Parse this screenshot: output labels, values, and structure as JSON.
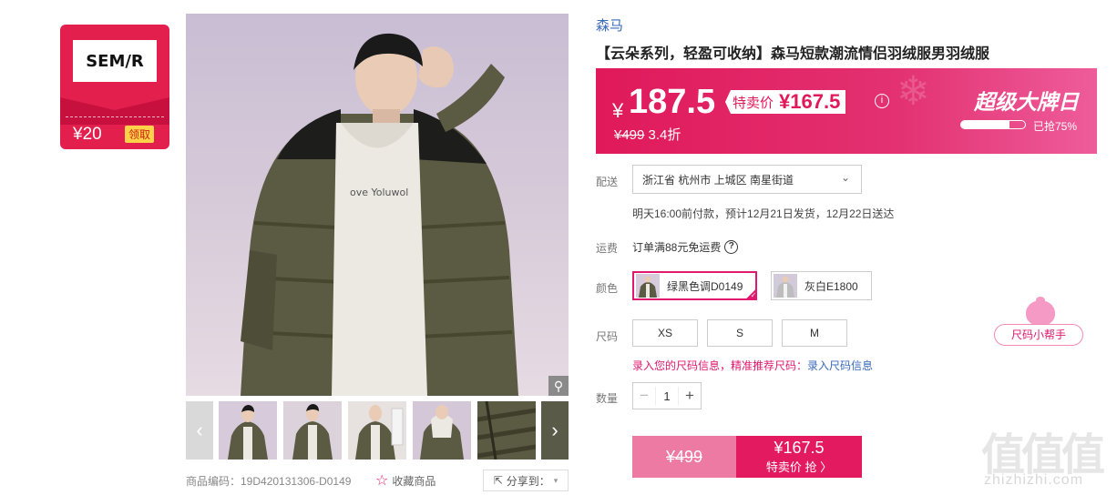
{
  "brand_card": {
    "logo_text": "SEM/R",
    "coupon_amount": "¥20",
    "claim_label": "领取"
  },
  "gallery": {
    "zoom_icon": "magnifier-icon",
    "prev_icon": "chevron-left-icon",
    "next_icon": "chevron-right-icon",
    "thumbnail_count": 6
  },
  "meta": {
    "product_code": "商品编码：19D420131306-D0149",
    "favorite_label": "收藏商品",
    "share_label": "分享到："
  },
  "product": {
    "brand": "森马",
    "title": "【云朵系列，轻盈可收纳】森马短款潮流情侣羽绒服男羽绒服"
  },
  "price": {
    "currency": "¥",
    "current": "187.5",
    "promo_label": "特卖价",
    "promo_price": "¥167.5",
    "original": "¥499",
    "discount": "3.4折",
    "event_name": "超级大牌日",
    "sold_label": "已抢75%",
    "sold_fraction": 0.75,
    "accent": "#e0195a"
  },
  "delivery": {
    "label": "配送",
    "location": "浙江省 杭州市 上城区 南星街道",
    "note": "明天16:00前付款，预计12月21日发货，12月22日送达"
  },
  "shipping_fee": {
    "label": "运费",
    "text": "订单满88元免运费"
  },
  "color": {
    "label": "颜色",
    "options": [
      {
        "name": "绿黑色调D0149",
        "selected": true
      },
      {
        "name": "灰白E1800",
        "selected": false
      }
    ]
  },
  "size": {
    "label": "尺码",
    "options": [
      "XS",
      "S",
      "M"
    ],
    "hint_prefix": "录入您的尺码信息，精准推荐尺码：",
    "hint_link": "录入尺码信息",
    "helper_label": "尺码小帮手"
  },
  "quantity": {
    "label": "数量",
    "value": "1",
    "minus": "−",
    "plus": "+"
  },
  "buy": {
    "original_price": "¥499",
    "sale_price": "¥167.5",
    "sale_label": "特卖价 抢 〉"
  },
  "watermark": {
    "text": "zhizhizhi.com"
  }
}
